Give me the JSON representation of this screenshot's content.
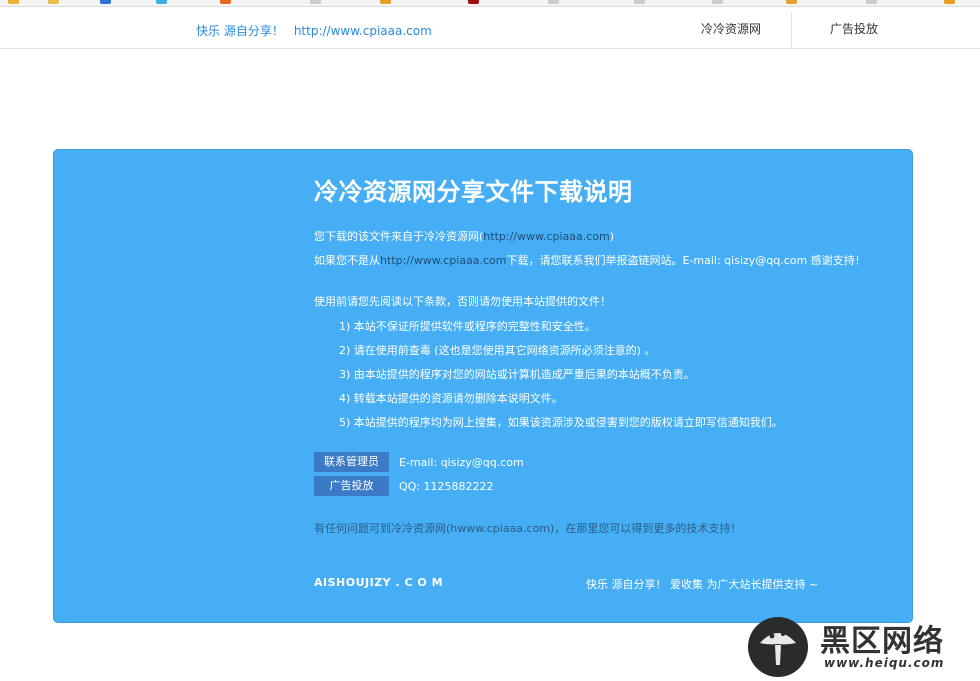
{
  "topbar": {
    "slogan": "快乐 源自分享！",
    "url": "http://www.cpiaaa.com",
    "nav_site": "冷冷资源网",
    "nav_ad": "广告投放"
  },
  "card": {
    "title": "冷冷资源网分享文件下载说明",
    "source_prefix": "您下载的该文件来自于冷冷资源网(",
    "source_url": "http://www.cpiaaa.com",
    "source_suffix": ")",
    "report_prefix": "如果您不是从",
    "report_url": "http://www.cpiaaa.com",
    "report_suffix": "下载，请您联系我们举报盗链网站。E-mail: qisizy@qq.com 感谢支持！",
    "rules_intro": "使用前请您先阅读以下条款，否则请勿使用本站提供的文件！",
    "rules": [
      "1) 本站不保证所提供软件或程序的完整性和安全性。",
      "2) 请在使用前查毒 (这也是您使用其它网络资源所必须注意的) 。",
      "3) 由本站提供的程序对您的网站或计算机造成严重后果的本站概不负责。",
      "4) 转载本站提供的资源请勿删除本说明文件。",
      "5) 本站提供的程序均为网上搜集，如果该资源涉及或侵害到您的版权请立即写信通知我们。"
    ],
    "contact_button": "联系管理员",
    "contact_email": "E-mail: qisizy@qq.com",
    "ad_button": "广告投放",
    "ad_qq": "QQ: 1125882222",
    "footer_note": "有任何问题可到冷冷资源网(hwww.cpiaaa.com)，在那里您可以得到更多的技术支持！",
    "brand": "AISHOUJIZY . C O M",
    "tagline": "快乐 源自分享！ 爱收集 为广大站长提供支持 ~"
  },
  "watermark": {
    "title": "黑区网络",
    "url": "www.heiqu.com",
    "icon": "mushroom-logo-icon"
  },
  "colors": {
    "card_bg": "#45aef5",
    "button_bg": "#3b7ac7",
    "link": "#2a8ad8"
  }
}
